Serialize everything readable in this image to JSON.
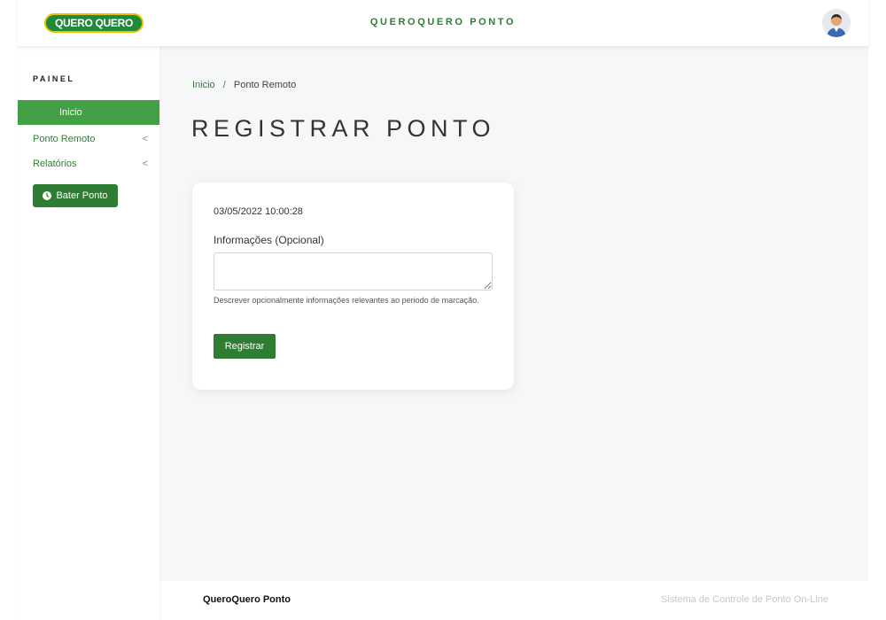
{
  "header": {
    "logo_text": "QUERO QUERO",
    "brand": "QUEROQUERO PONTO"
  },
  "sidebar": {
    "heading": "PAINEL",
    "items": [
      {
        "label": "Inicio",
        "active": true
      },
      {
        "label": "Ponto Remoto",
        "chevron": "<"
      },
      {
        "label": "Relatórios",
        "chevron": "<"
      }
    ],
    "bater_button": {
      "label": "Bater Ponto",
      "icon": "clock-icon"
    }
  },
  "breadcrumb": {
    "home": "Inicio",
    "separator": "/",
    "current": "Ponto Remoto"
  },
  "page_title": "REGISTRAR PONTO",
  "form": {
    "datetime": "03/05/2022 10:00:28",
    "info_label": "Informações (Opcional)",
    "info_value": "",
    "help_text": "Descrever opcionalmente informações relevantes ao periodo de marcação.",
    "submit_label": "Registrar"
  },
  "footer": {
    "left": "QueroQuero Ponto",
    "right": "Sistema de Controle de Ponto On-Line"
  },
  "colors": {
    "accent": "#2e7d32",
    "active_item": "#43a047",
    "background": "#f6f7f9"
  }
}
